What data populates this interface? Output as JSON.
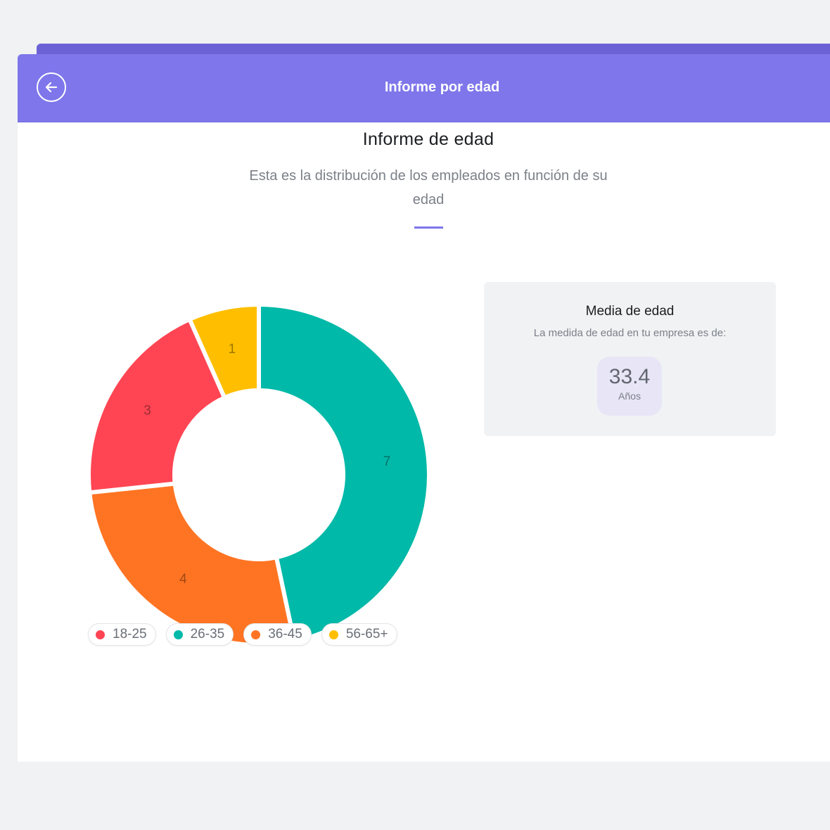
{
  "header": {
    "title": "Informe por edad",
    "back_icon": "arrow-left-circle-icon"
  },
  "report": {
    "title": "Informe de edad",
    "subtitle": "Esta es la distribución de los empleados en función de su edad"
  },
  "average": {
    "title": "Media de edad",
    "subtitle": "La medida de edad en tu empresa es de:",
    "value": "33.4",
    "unit": "Años"
  },
  "chart_data": {
    "type": "pie",
    "variant": "donut",
    "start_category": "26-35",
    "direction": "clockwise",
    "categories": [
      "26-35",
      "36-45",
      "18-25",
      "56-65+"
    ],
    "values": [
      7,
      4,
      3,
      1
    ],
    "colors": [
      "#00b9a8",
      "#ff7422",
      "#ff4553",
      "#ffbf00"
    ],
    "data_labels": [
      "7",
      "4",
      "3",
      "1"
    ],
    "legend_placement": "bottom"
  },
  "legend": [
    {
      "label": "18-25",
      "color": "#ff4553"
    },
    {
      "label": "26-35",
      "color": "#00b9a8"
    },
    {
      "label": "36-45",
      "color": "#ff7422"
    },
    {
      "label": "56-65+",
      "color": "#ffbf00"
    }
  ]
}
